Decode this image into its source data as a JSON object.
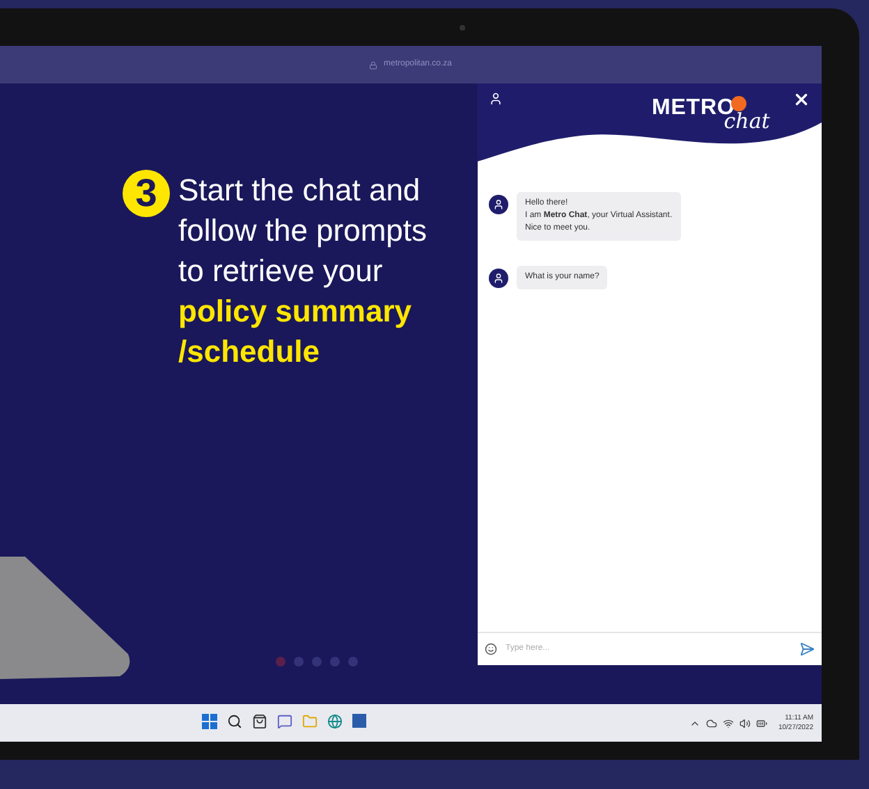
{
  "browser": {
    "address": "metropolitan.co.za"
  },
  "step": {
    "number": "3",
    "text": "Start the chat and follow the prompts to retrieve your **policy summary /schedule**"
  },
  "carousel": {
    "dots": [
      {
        "selected": true
      },
      {
        "selected": false
      },
      {
        "selected": false
      },
      {
        "selected": false
      },
      {
        "selected": false
      }
    ]
  },
  "chat": {
    "logo": {
      "word": "METRO",
      "script": "chat"
    },
    "messages": [
      {
        "lines": [
          "Hello there!",
          "I am **Metro Chat**, your Virtual Assistant.",
          "Nice to meet you."
        ]
      },
      {
        "lines": [
          "What is your name?"
        ]
      }
    ],
    "input": {
      "placeholder": "Type here..."
    }
  },
  "taskbar": {
    "time": "11:11 AM",
    "date": "10/27/2022"
  }
}
